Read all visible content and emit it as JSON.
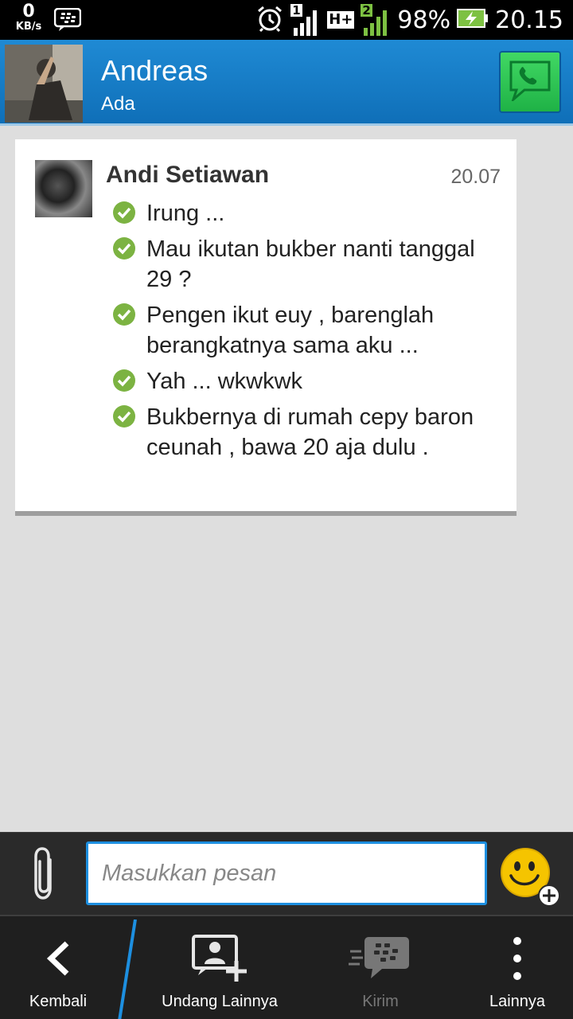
{
  "status_bar": {
    "net_speed_value": "0",
    "net_speed_unit": "KB/s",
    "sim1": "1",
    "network_type": "H+",
    "sim2": "2",
    "battery": "98%",
    "time": "20.15"
  },
  "header": {
    "contact_name": "Andreas",
    "contact_status": "Ada"
  },
  "message": {
    "sender": "Andi Setiawan",
    "time": "20.07",
    "items": [
      "Irung ...",
      "Mau ikutan bukber nanti tanggal 29 ?",
      "Pengen ikut euy , barenglah berangkatnya sama aku ...",
      "Yah ... wkwkwk",
      "Bukbernya di rumah cepy baron ceunah , bawa 20 aja dulu ."
    ]
  },
  "input": {
    "placeholder": "Masukkan pesan",
    "value": ""
  },
  "nav": {
    "back": "Kembali",
    "invite": "Undang Lainnya",
    "send": "Kirim",
    "more": "Lainnya"
  },
  "colors": {
    "header": "#1a7fcb",
    "accent": "#1d8fe0",
    "check": "#7cb342",
    "call_button": "#2cc451"
  },
  "icons": {
    "status": [
      "bbm-icon",
      "alarm-icon",
      "signal-icon",
      "battery-charging-icon"
    ],
    "header": [
      "phone-icon"
    ],
    "input": [
      "paperclip-icon",
      "emoji-add-icon"
    ],
    "nav": [
      "chevron-left-icon",
      "add-contact-icon",
      "bbm-send-icon",
      "more-vertical-icon"
    ]
  }
}
